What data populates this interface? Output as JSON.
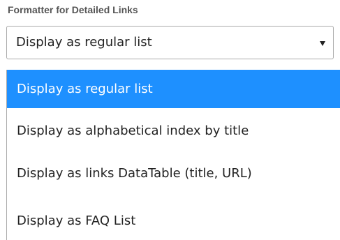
{
  "field": {
    "label": "Formatter for Detailed Links",
    "selected_value": "Display as regular list",
    "caret_icon": "caret-down-icon"
  },
  "dropdown": {
    "options": [
      {
        "label": "Display as regular list",
        "selected": true
      },
      {
        "label": "Display as alphabetical index by title",
        "selected": false
      },
      {
        "label": "Display as links DataTable (title, URL)",
        "selected": false
      },
      {
        "label": "Display as FAQ List",
        "selected": false
      }
    ],
    "highlight_color": "#1e90ff"
  }
}
